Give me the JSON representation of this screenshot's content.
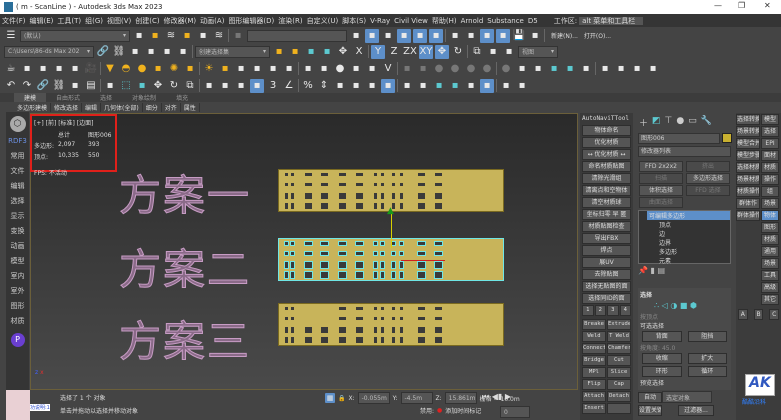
{
  "window": {
    "title": "( m - ScanLine ) - Autodesk 3ds Max 2023",
    "minimize": "—",
    "maximize": "❐",
    "close": "✕"
  },
  "menu": [
    "文件(F)",
    "编辑(E)",
    "工具(T)",
    "组(G)",
    "视图(V)",
    "创建(C)",
    "修改器(M)",
    "动画(A)",
    "图形编辑器(D)",
    "渲染(R)",
    "自定义(U)",
    "脚本(S)",
    "V-Ray",
    "Civil View",
    "帮助(H)",
    "Arnold",
    "Substance",
    "D5"
  ],
  "workspace": {
    "label": "工作区:",
    "value": "alt 菜单和工具栏"
  },
  "toolbar": {
    "layer_dropdown": "(默认)",
    "path_dropdown": "C:\\Users\\86-ds Max 202",
    "selection_set": "创建选择集",
    "view_dropdown": "视图",
    "new_label": "新建(N)...",
    "open_label": "打开(O)...",
    "row1": [
      "layer-manager",
      "add-layer",
      "layer-stack",
      "select-layer",
      "layer-mirror",
      "layers",
      "layers-hidden"
    ],
    "row1b": [
      "layer-tools",
      "snap-grid",
      "pivot",
      "snap-2d",
      "snap-25d",
      "snap-3d",
      "brush",
      "cone",
      "snap-toggle",
      "axis-constraint",
      "save",
      "import"
    ],
    "row2": [
      "link",
      "unlink",
      "bind-space-warp",
      "teapot-render",
      "teapot-active",
      "named-selection"
    ],
    "row2b": [
      "select-object",
      "select-by-name",
      "rect-region",
      "window-crossing",
      "move",
      "axis-x",
      "axis-y",
      "axis-z",
      "axis-zx",
      "axis-xy",
      "move-transform",
      "rotate",
      "scale",
      "place",
      "mirror"
    ],
    "row3": [
      "teapot",
      "sphere-gizmo",
      "camera-box",
      "shape-light",
      "video",
      "camera",
      "spot-light",
      "dome",
      "sun-sphere",
      "gear-sun",
      "omni",
      "bulb",
      "sunlight",
      "skylight",
      "grid-sphere",
      "shaded-sphere",
      "biped",
      "cloth",
      "particles",
      "box-select",
      "material-sphere",
      "multi-material",
      "container",
      "v-logo",
      "pen",
      "add-helper",
      "dot-small",
      "dot-medium",
      "dot-large",
      "dot-xl",
      "dot-xxl",
      "mirror-tool",
      "rect-select",
      "curve-editor",
      "dope-sheet",
      "track-view",
      "schematic",
      "render-setup",
      "render-frame",
      "render-active"
    ],
    "row4": [
      "undo",
      "redo",
      "link-2",
      "unlink-2",
      "bind-2",
      "select",
      "select-list",
      "rect",
      "paint-select",
      "move-4",
      "rotate-4",
      "scale-4",
      "place-4",
      "snap-align",
      "move-axis",
      "transform-type",
      "snap-3",
      "angle-snap",
      "percent-snap",
      "spinner-snap",
      "edit-named-sel",
      "mirror-4",
      "align",
      "scene-explorer",
      "layer-explorer",
      "toggle-ribbon",
      "curve-editor-4",
      "dope-4",
      "schematic-4",
      "material-editor",
      "render-setup-4",
      "render-frame-4"
    ]
  },
  "ribbon": {
    "tabs": [
      "建模",
      "自由形式",
      "选择",
      "对象绘制",
      "填充"
    ],
    "sub": [
      "多边形建模",
      "修改选择",
      "编辑",
      "几何体(全部)",
      "细分",
      "对齐",
      "属性"
    ]
  },
  "sidebar": {
    "title": "RDF3",
    "items": [
      "常用",
      "文件",
      "编辑",
      "选择",
      "显示",
      "变换",
      "动画",
      "模型",
      "室内",
      "室外",
      "图形",
      "材质"
    ]
  },
  "viewport": {
    "label": "[+] [前] [标准] [边面]",
    "stats": {
      "col_total": "总计",
      "col_object": "图形006",
      "polys_label": "多边形:",
      "polys_total": "2,097",
      "polys_obj": "393",
      "verts_label": "顶点:",
      "verts_total": "10,335",
      "verts_obj": "550",
      "fps_label": "FPS:",
      "fps_value": "不活动"
    },
    "plans": [
      "方案一",
      "方案二",
      "方案三"
    ],
    "axis": {
      "z": "z",
      "x": "x"
    }
  },
  "script_panel": {
    "title": "AutoNaviTTool",
    "buttons": [
      "物体命名",
      "优化材质",
      "↔ 优化材质 ↔",
      "命名材质贴图",
      "清除光滑组",
      "清离点和空物体",
      "清空材质球",
      "坐标归零 早 匿",
      "材质贴图检查",
      "导出FBX",
      "焊点",
      "展UV",
      "去除贴图",
      "选择无贴图的面",
      "选择同ID的面"
    ],
    "numbers": [
      "1",
      "2",
      "3",
      "4"
    ],
    "pairs": [
      [
        "Breake",
        "Extrude"
      ],
      [
        "Weld",
        "T Weld"
      ],
      [
        "Connect",
        "Chamfer"
      ],
      [
        "Bridge",
        "Cut"
      ],
      [
        "MPl",
        "Slice"
      ],
      [
        "Flip",
        "Cap"
      ],
      [
        "Attach",
        "Detach"
      ],
      [
        "Insert",
        ""
      ]
    ]
  },
  "command_panel": {
    "object_name": "图形006",
    "object_color": "#c8b030",
    "modifier_list": "修改器列表",
    "buttons": [
      "FFD 2x2x2",
      "挤出",
      "扫描",
      "多边形选择",
      "体积选择",
      "FFD 选择",
      "曲面选择"
    ],
    "stack": [
      "可编辑多边形",
      "顶点",
      "边",
      "边界",
      "多边形",
      "元素"
    ],
    "selection": {
      "title": "选择",
      "by_vertex": "按顶点",
      "group_label": "可选选择",
      "btn1": "背面",
      "btn2": "阻挡",
      "by_angle": "按角度:",
      "angle": "45.0",
      "shrink": "收缩",
      "grow": "扩大",
      "ring": "环形",
      "loop": "循环",
      "preview": "预览选择"
    }
  },
  "far_panel": {
    "buttons": [
      "选择转换",
      "场景转换",
      "模型合并",
      "模型步骤",
      "选择材质",
      "场景材质",
      "材质操作",
      "群体作",
      "群体操作"
    ],
    "col2": [
      "模型",
      "选择",
      "EPI",
      "面材",
      "材质",
      "操作",
      "组",
      "场景",
      "物体",
      "图形",
      "材质",
      "通用",
      "场景",
      "工具",
      "高级",
      "其它"
    ],
    "abc": [
      "A",
      "B",
      "C"
    ],
    "logo": "AK",
    "logo_caption": "酷酷沿科"
  },
  "anim": {
    "auto_key": "自动",
    "set_key": "设置关键点",
    "key_filter": "选定对象",
    "filters": "过滤器..."
  },
  "status": {
    "selected": "选择了 1 个 对象",
    "hint": "单击并拖动以选择并移动对象",
    "x_label": "X:",
    "x": "-0.055m",
    "y_label": "Y:",
    "y": "-4.5m",
    "z_label": "Z:",
    "z": "15.861m",
    "grid": "栅格 = 10.0m",
    "disabled": "禁用:",
    "add_time_tag": "添加时间标记",
    "frame": "0",
    "script_listener": "功说明:1"
  }
}
